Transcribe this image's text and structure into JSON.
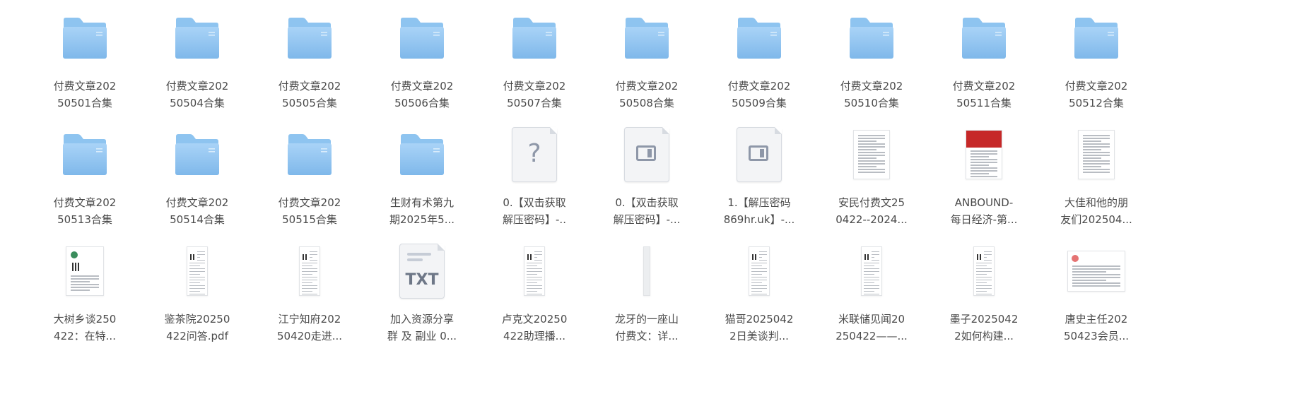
{
  "files": [
    {
      "line1": "付费文章202",
      "line2": "50501合集",
      "type": "folder"
    },
    {
      "line1": "付费文章202",
      "line2": "50504合集",
      "type": "folder"
    },
    {
      "line1": "付费文章202",
      "line2": "50505合集",
      "type": "folder"
    },
    {
      "line1": "付费文章202",
      "line2": "50506合集",
      "type": "folder"
    },
    {
      "line1": "付费文章202",
      "line2": "50507合集",
      "type": "folder"
    },
    {
      "line1": "付费文章202",
      "line2": "50508合集",
      "type": "folder"
    },
    {
      "line1": "付费文章202",
      "line2": "50509合集",
      "type": "folder"
    },
    {
      "line1": "付费文章202",
      "line2": "50510合集",
      "type": "folder"
    },
    {
      "line1": "付费文章202",
      "line2": "50511合集",
      "type": "folder"
    },
    {
      "line1": "付费文章202",
      "line2": "50512合集",
      "type": "folder"
    },
    {
      "line1": "付费文章202",
      "line2": "50513合集",
      "type": "folder"
    },
    {
      "line1": "付费文章202",
      "line2": "50514合集",
      "type": "folder"
    },
    {
      "line1": "付费文章202",
      "line2": "50515合集",
      "type": "folder"
    },
    {
      "line1": "生财有术第九",
      "line2": "期2025年5...",
      "type": "folder"
    },
    {
      "line1": "0.【双击获取",
      "line2": "解压密码】-..",
      "type": "unknown"
    },
    {
      "line1": "0.【双击获取",
      "line2": "解压密码】-...",
      "type": "window"
    },
    {
      "line1": "1.【解压密码",
      "line2": "869hr.uk】-...",
      "type": "window"
    },
    {
      "line1": "安民付费文25",
      "line2": "0422--2024...",
      "type": "doc"
    },
    {
      "line1": "ANBOUND-",
      "line2": "每日经济-第...",
      "type": "doc-red"
    },
    {
      "line1": "大佳和他的朋",
      "line2": "友们202504...",
      "type": "doc"
    },
    {
      "line1": "大树乡谈250",
      "line2": "422：在特...",
      "type": "doc-qr"
    },
    {
      "line1": "鉴茶院20250",
      "line2": "422问答.pdf",
      "type": "doc-narrow"
    },
    {
      "line1": "江宁知府202",
      "line2": "50420走进...",
      "type": "doc-narrow"
    },
    {
      "line1": "加入资源分享",
      "line2": "群 及 副业 0...",
      "type": "txt"
    },
    {
      "line1": "卢克文20250",
      "line2": "422助理播...",
      "type": "doc-narrow"
    },
    {
      "line1": "龙牙的一座山",
      "line2": "付费文：详...",
      "type": "doc-strip"
    },
    {
      "line1": "猫哥2025042",
      "line2": "2日美谈判...",
      "type": "doc-narrow"
    },
    {
      "line1": "米联储见闻20",
      "line2": "250422——...",
      "type": "doc-narrow"
    },
    {
      "line1": "墨子2025042",
      "line2": "2如何构建...",
      "type": "doc-narrow"
    },
    {
      "line1": "唐史主任202",
      "line2": "50423会员...",
      "type": "doc-wide"
    }
  ],
  "icons": {
    "folder": "folder-icon",
    "unknown": "unknown-file-icon",
    "window": "app-file-icon",
    "txt": "txt-file-icon",
    "doc": "document-thumbnail"
  },
  "colors": {
    "folder_top": "#8ec4f0",
    "folder_body": "#a9d3f7",
    "label": "#4a4a4a"
  },
  "txt_label": "TXT",
  "unknown_glyph": "?"
}
